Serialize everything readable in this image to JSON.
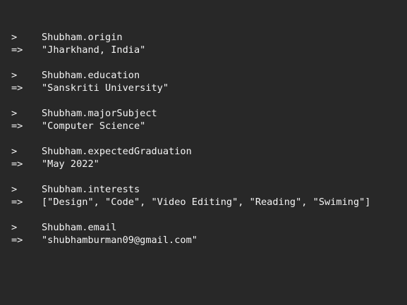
{
  "console": {
    "input_prompt": ">",
    "output_prompt": "=>",
    "entries": [
      {
        "command": "Shubham.origin",
        "result": "\"Jharkhand, India\""
      },
      {
        "command": "Shubham.education",
        "result": "\"Sanskriti University\""
      },
      {
        "command": "Shubham.majorSubject",
        "result": "\"Computer Science\""
      },
      {
        "command": "Shubham.expectedGraduation",
        "result": "\"May 2022\""
      },
      {
        "command": "Shubham.interests",
        "result": "[\"Design\", \"Code\", \"Video Editing\", \"Reading\", \"Swiming\"]"
      },
      {
        "command": "Shubham.email",
        "result": "\"shubhamburman09@gmail.com\""
      }
    ]
  }
}
